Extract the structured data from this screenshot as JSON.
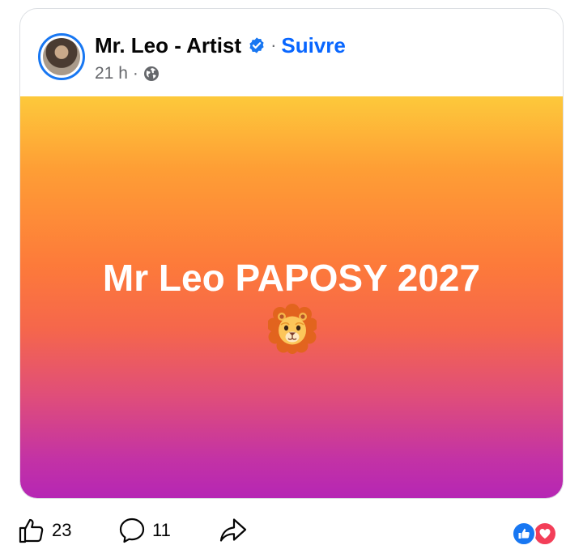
{
  "post": {
    "author": "Mr. Leo - Artist",
    "follow_label": "Suivre",
    "separator": "·",
    "time": "21 h",
    "text": "Mr Leo PAPOSY 2027",
    "emoji": "lion-face"
  },
  "engagement": {
    "likes": "23",
    "comments": "11"
  },
  "colors": {
    "accent": "#0866ff",
    "avatar_ring": "#1877f2",
    "gradient_top": "#fdc93b",
    "gradient_mid": "#fd7a3a",
    "gradient_bottom": "#b526b5",
    "love": "#f33e58"
  }
}
